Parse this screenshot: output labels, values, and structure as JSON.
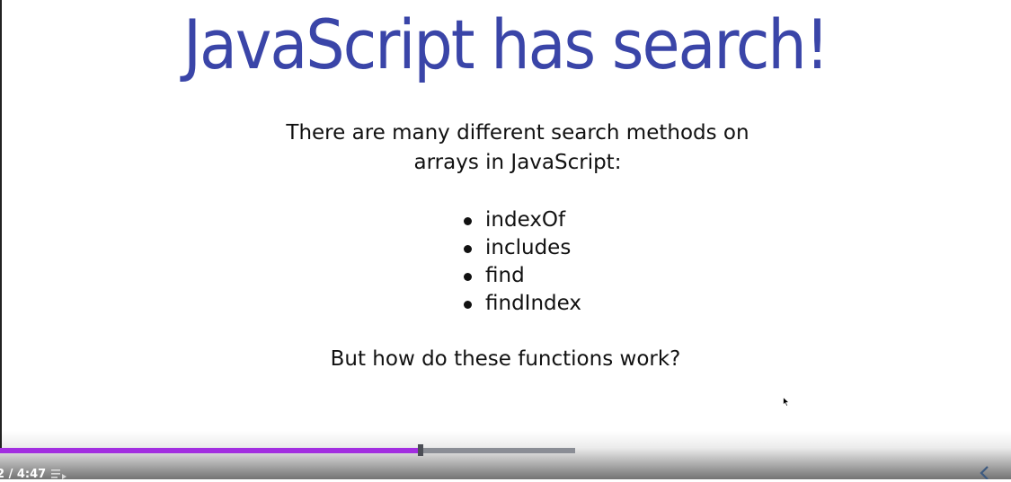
{
  "slide": {
    "title": "JavaScript has search!",
    "intro_line1": "There are many different search methods on",
    "intro_line2": "arrays in JavaScript:",
    "methods": [
      "indexOf",
      "includes",
      "find",
      "findIndex"
    ],
    "question": "But how do these functions work?"
  },
  "player": {
    "time_text": "2 / 4:47",
    "progress_fraction": 0.414,
    "buffered_fraction": 0.569,
    "colors": {
      "played": "#a22ee0",
      "buffered": "#8a8d95",
      "title": "#3a45a8"
    },
    "icons": [
      "playlist-icon",
      "chevron-left-icon"
    ]
  }
}
